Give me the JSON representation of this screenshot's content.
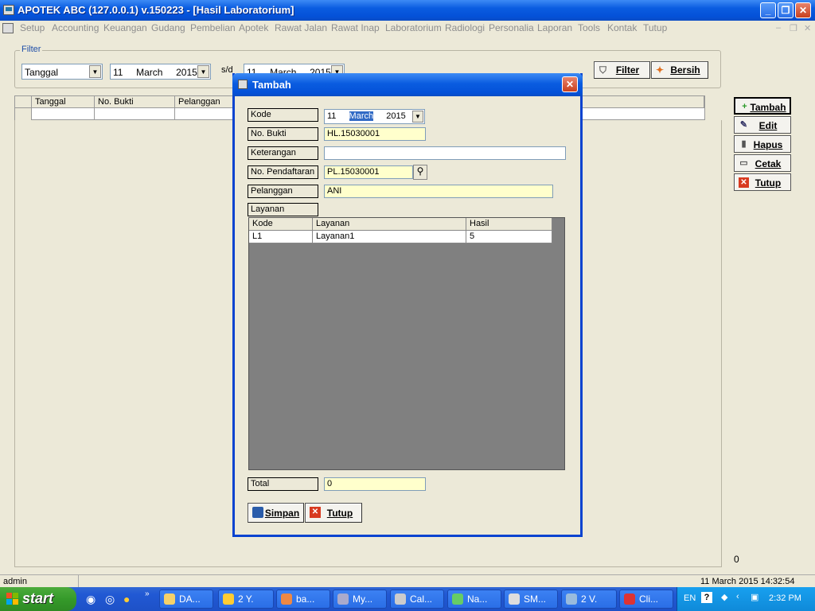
{
  "window": {
    "title": "APOTEK ABC (127.0.0.1) v.150223 - [Hasil Laboratorium]"
  },
  "menu": [
    "Setup",
    "Accounting",
    "Keuangan",
    "Gudang",
    "Pembelian",
    "Apotek",
    "Rawat Jalan",
    "Rawat Inap",
    "Laboratorium",
    "Radiologi",
    "Personalia",
    "Laporan",
    "Tools",
    "Kontak",
    "Tutup"
  ],
  "filter": {
    "label": "Filter",
    "field": "Tanggal",
    "date_from": "11     March     2015",
    "sd_label": "s/d",
    "date_to": "11     March     2015",
    "filter_btn": "Filter",
    "bersih_btn": "Bersih"
  },
  "grid": {
    "columns": [
      "Tanggal",
      "No. Bukti",
      "Pelanggan"
    ]
  },
  "side_buttons": {
    "tambah": "Tambah",
    "edit": "Edit",
    "hapus": "Hapus",
    "cetak": "Cetak",
    "tutup": "Tutup"
  },
  "count": "0",
  "status": {
    "user": "admin",
    "datetime": "11 March 2015  14:32:54"
  },
  "dialog": {
    "title": "Tambah",
    "labels": {
      "kode": "Kode",
      "no_bukti": "No. Bukti",
      "keterangan": "Keterangan",
      "no_pendaftaran": "No. Pendaftaran",
      "pelanggan": "Pelanggan",
      "layanan": "Layanan",
      "total": "Total"
    },
    "kode_day": "11",
    "kode_month": "March",
    "kode_year": "2015",
    "no_bukti": "HL.15030001",
    "keterangan": "",
    "no_pendaftaran": "PL.15030001",
    "pelanggan": "ANI",
    "layanan_columns": [
      "Kode",
      "Layanan",
      "Hasil"
    ],
    "layanan_rows": [
      {
        "kode": "L1",
        "layanan": "Layanan1",
        "hasil": "5"
      }
    ],
    "total": "0",
    "simpan_btn": "Simpan",
    "tutup_btn": "Tutup"
  },
  "taskbar": {
    "start": "start",
    "buttons": [
      "DA...",
      "2 Y.",
      "ba...",
      "My...",
      "Cal...",
      "Na...",
      "SM...",
      "2 V.",
      "Cli..."
    ],
    "lang": "EN",
    "clock": "2:32 PM"
  }
}
